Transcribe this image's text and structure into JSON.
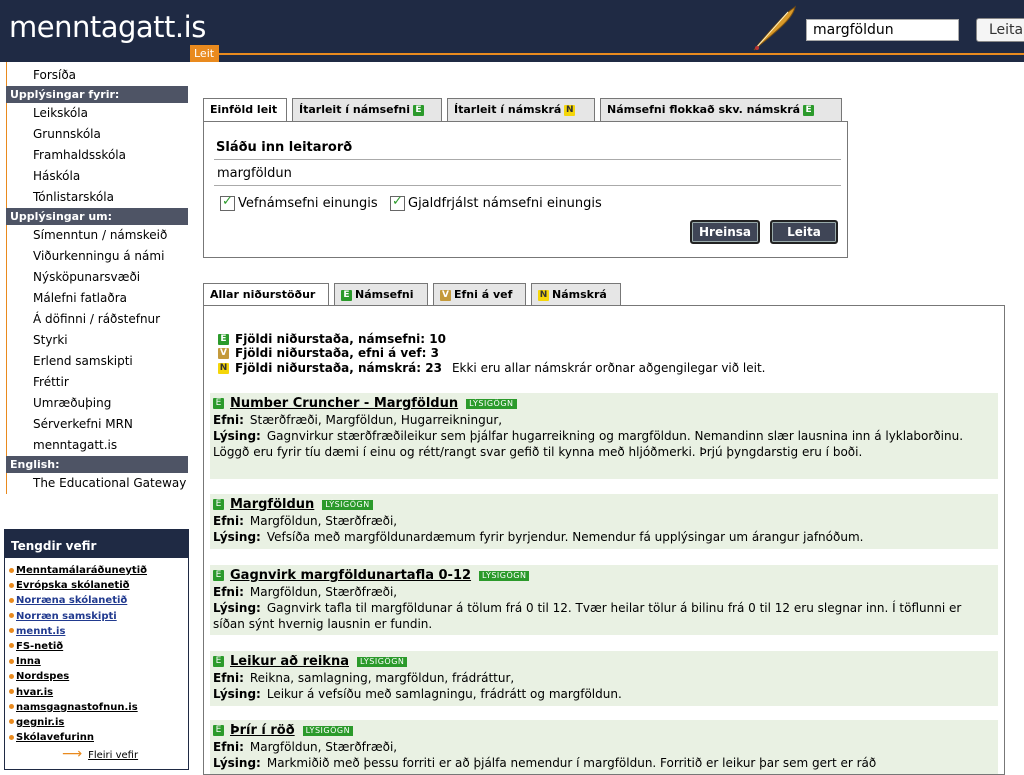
{
  "header": {
    "logo": "menntagatt.is",
    "leit_tab": "Leit",
    "search_value": "margföldun",
    "search_button": "Leita"
  },
  "sidebar": {
    "top_item": "Forsíða",
    "section1_head": "Upplýsingar fyrir:",
    "section1": [
      "Leikskóla",
      "Grunnskóla",
      "Framhaldsskóla",
      "Háskóla",
      "Tónlistarskóla"
    ],
    "section2_head": "Upplýsingar um:",
    "section2": [
      "Símenntun / námskeið",
      "Viðurkenningu á námi",
      "Nýsköpunarsvæði",
      "Málefni fatlaðra",
      "Á döfinni / ráðstefnur",
      "Styrki",
      "Erlend samskipti",
      "Fréttir",
      "Umræðuþing",
      "Sérverkefni MRN",
      "menntagatt.is"
    ],
    "section3_head": "English:",
    "section3": [
      "The Educational Gateway"
    ],
    "tengdir_head": "Tengdir vefir",
    "links": [
      "Menntamálaráðuneytið",
      "Evrópska skólanetið",
      "Norræna skólanetið",
      "Norræn samskipti",
      "mennt.is",
      "FS-netið",
      "Inna",
      "Nordspes",
      "hvar.is",
      "namsgagnastofnun.is",
      "gegnir.is",
      "Skólavefurinn"
    ],
    "more_link": "Fleiri vefir"
  },
  "search": {
    "tabs": [
      "Einföld leit",
      "Ítarleit í námsefni",
      "Ítarleit í námskrá",
      "Námsefni flokkað skv. námskrá"
    ],
    "heading": "Sláðu inn leitarorð",
    "query": "margföldun",
    "checkbox1": "Vefnámsefni einungis",
    "checkbox2": "Gjaldfrjálst námsefni einungis",
    "clear_button": "Hreinsa",
    "search_button": "Leita"
  },
  "results": {
    "tabs": [
      "Allar niðurstöður",
      "Námsefni",
      "Efni á vef",
      "Námskrá"
    ],
    "counts": [
      {
        "badge": "E",
        "text": "Fjöldi niðurstaða, námsefni: 10",
        "note": ""
      },
      {
        "badge": "V",
        "text": "Fjöldi niðurstaða, efni á vef: 3",
        "note": ""
      },
      {
        "badge": "N",
        "text": "Fjöldi niðurstaða, námskrá: 23",
        "note": "Ekki eru allar námskrár orðnar aðgengilegar við leit."
      }
    ],
    "efni_label": "Efni:",
    "lysing_label": "Lýsing:",
    "tag": "LÝSIGÖGN",
    "items": [
      {
        "title": "Number Cruncher - Margföldun",
        "efni": "Stærðfræði, Margföldun, Hugarreikningur,",
        "lysing": "Gagnvirkur stærðfræðileikur sem þjálfar hugarreikning og margföldun. Nemandinn slær lausnina inn á lyklaborðinu. Löggð eru fyrir tíu dæmi í einu og rétt/rangt svar gefið til kynna með hljóðmerki. Þrjú þyngdarstig eru í boði."
      },
      {
        "title": "Margföldun",
        "efni": "Margföldun, Stærðfræði,",
        "lysing": "Vefsíða með margföldunardæmum fyrir byrjendur. Nemendur fá upplýsingar um árangur jafnóðum."
      },
      {
        "title": "Gagnvirk margföldunartafla 0-12",
        "efni": "Margföldun, Stærðfræði,",
        "lysing": "Gagnvirk tafla til margföldunar á tölum frá 0 til 12. Tvær heilar tölur á bilinu frá 0 til 12 eru slegnar inn. Í töflunni er síðan sýnt hvernig lausnin er fundin."
      },
      {
        "title": "Leikur að reikna",
        "efni": "Reikna, samlagning, margföldun, frádráttur,",
        "lysing": "Leikur á vefsíðu með samlagningu, frádrátt og margföldun."
      },
      {
        "title": "Þrír í röð",
        "efni": "Margföldun, Stærðfræði,",
        "lysing": "Markmiðið með þessu forriti er að þjálfa nemendur í margföldun. Forritið er leikur þar sem gert er ráð"
      }
    ]
  }
}
